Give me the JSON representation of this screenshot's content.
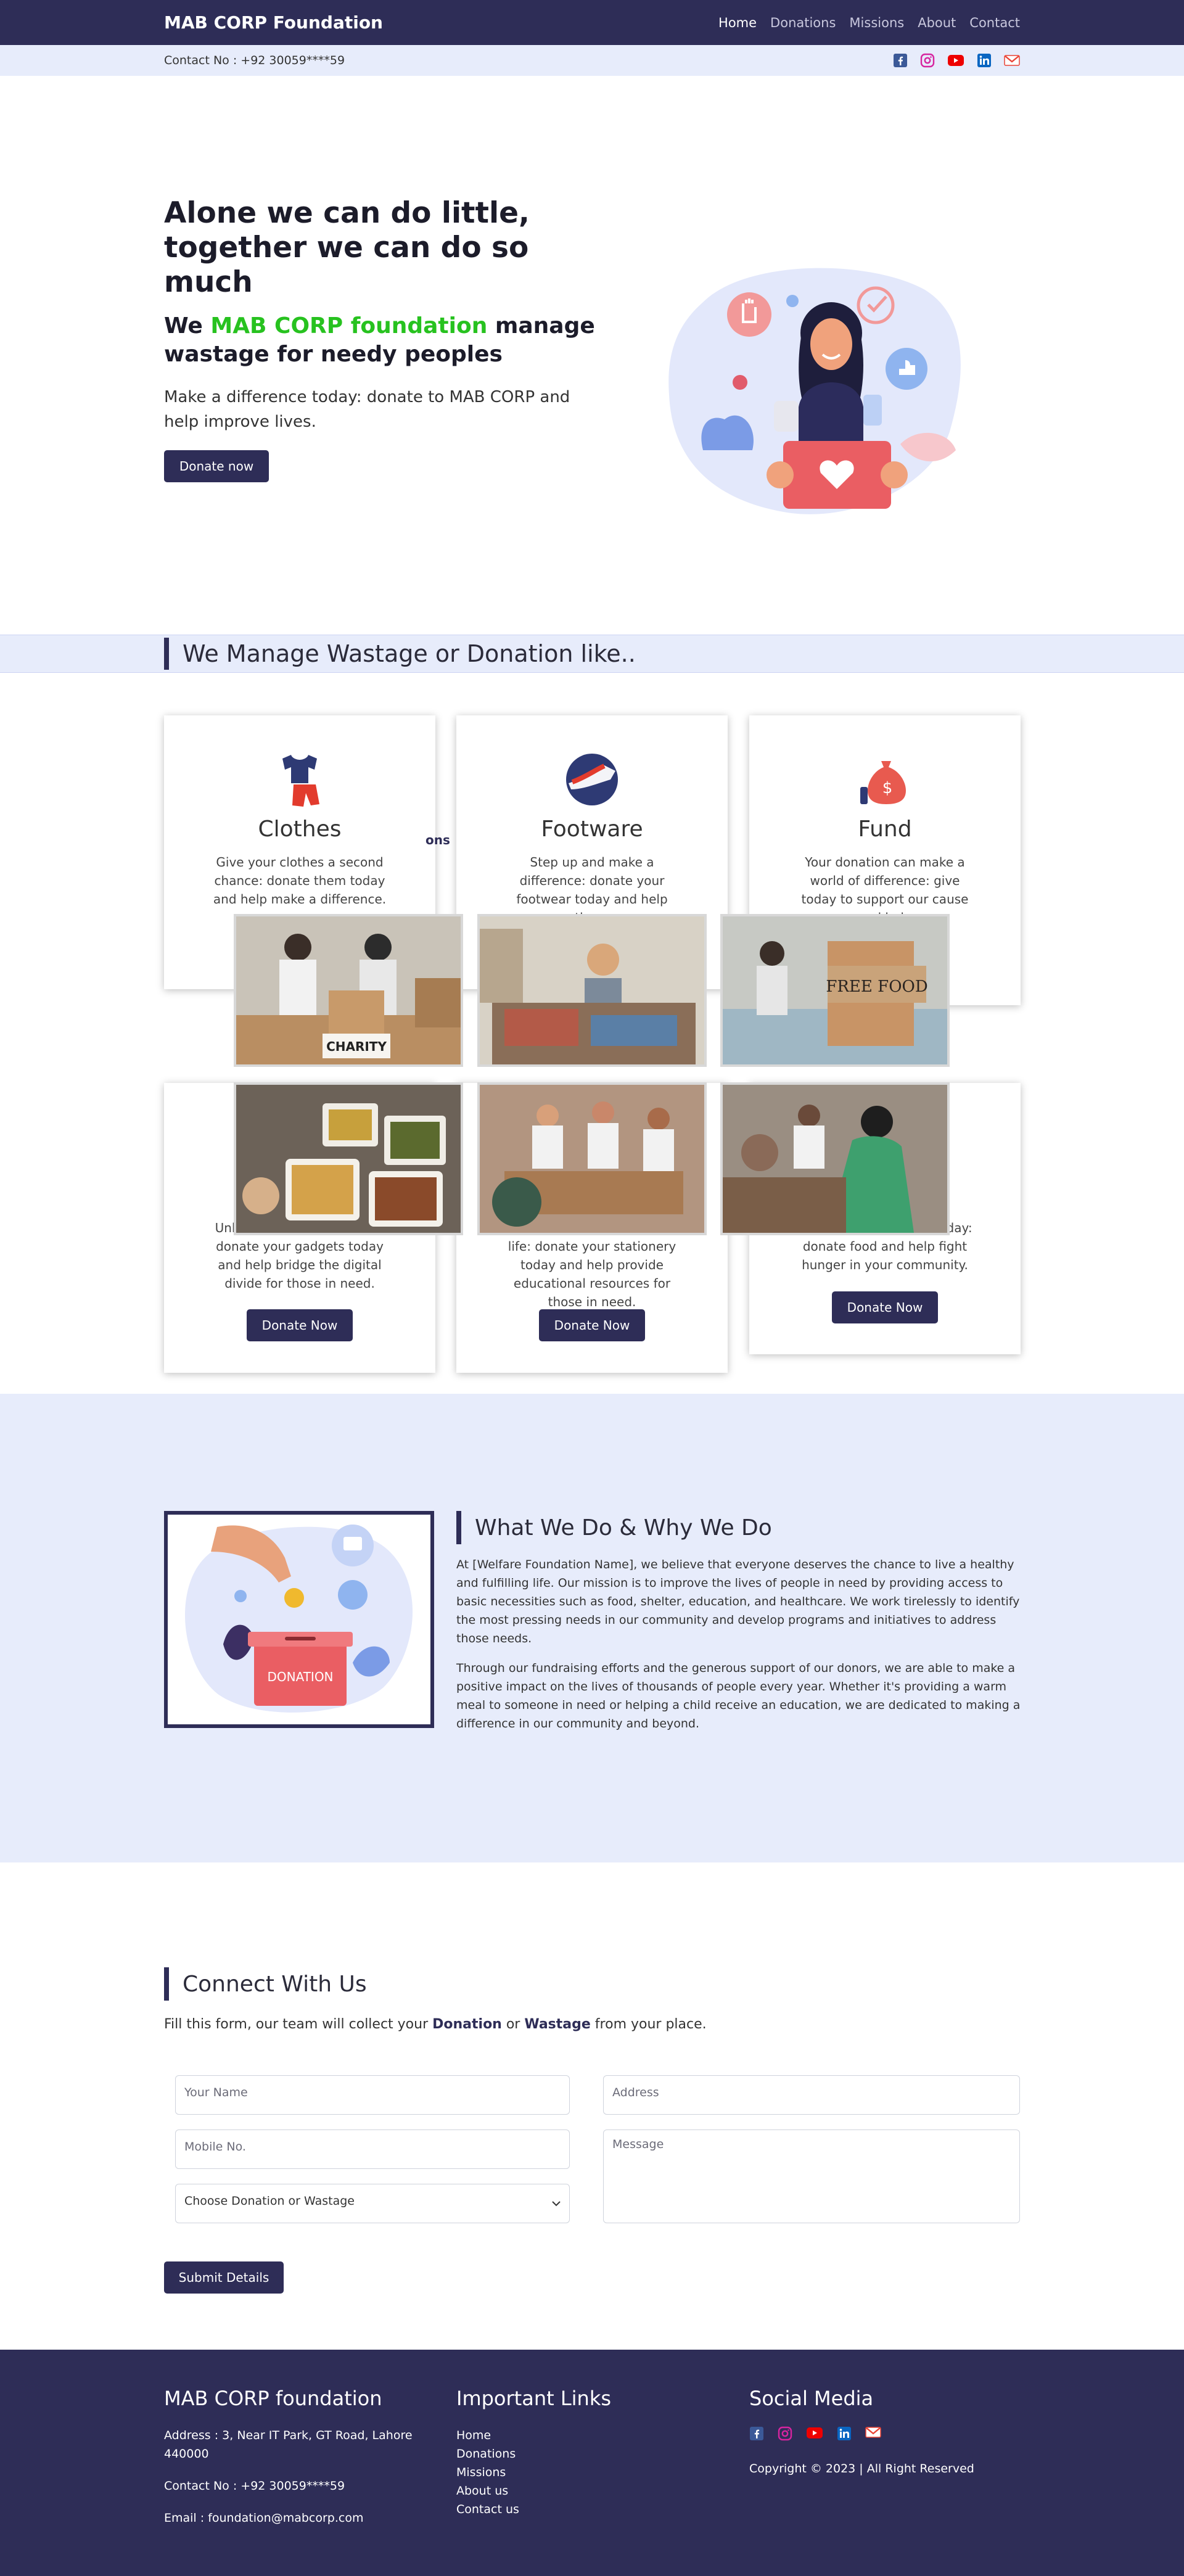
{
  "nav": {
    "brand": "MAB CORP Foundation",
    "links": [
      "Home",
      "Donations",
      "Missions",
      "About",
      "Contact"
    ]
  },
  "contact_bar": {
    "text": "Contact No : +92 30059****59",
    "social_icons": [
      "facebook-icon",
      "instagram-icon",
      "youtube-icon",
      "linkedin-icon",
      "gmail-icon"
    ]
  },
  "hero": {
    "title_line1": "Alone we can do little,",
    "title_line2": "together we can do so much",
    "sub_before": "We ",
    "sub_highlight": "MAB CORP foundation",
    "sub_after": " manage wastage for needy peoples",
    "description": "Make a difference today: donate to MAB CORP and help improve lives.",
    "button": "Donate now"
  },
  "manage": {
    "title": "We Manage Wastage or Donation like..",
    "cards": [
      {
        "title": "Clothes",
        "desc": "Give your clothes a second chance: donate them today and help make a difference."
      },
      {
        "title": "Footware",
        "desc": "Step up and make a difference: donate your footwear today and help those"
      },
      {
        "title": "Fund",
        "desc": "Your donation can make a world of difference: give today to support our cause and help"
      },
      {
        "desc": "Unlock the power of giving: donate your gadgets today and help bridge the digital divide for those in need.",
        "button": "Donate Now"
      },
      {
        "desc": "Make a mark in someone's life: donate your stationery today and help provide educational resources for those in need.",
        "button": "Donate Now"
      },
      {
        "desc": "Feed a hungry mouth today: donate food and help fight hunger in your community.",
        "button": "Donate Now"
      }
    ],
    "overlap_fragment": "ons"
  },
  "whatwedo": {
    "title": "What We Do & Why We Do",
    "para1": "At [Welfare Foundation Name], we believe that everyone deserves the chance to live a healthy and fulfilling life. Our mission is to improve the lives of people in need by providing access to basic necessities such as food, shelter, education, and healthcare. We work tirelessly to identify the most pressing needs in our community and develop programs and initiatives to address those needs.",
    "para2": "Through our fundraising efforts and the generous support of our donors, we are able to make a positive impact on the lives of thousands of people every year. Whether it's providing a warm meal to someone in need or helping a child receive an education, we are dedicated to making a difference in our community and beyond.",
    "image_label": "DONATION"
  },
  "connect": {
    "title": "Connect With Us",
    "desc_before": "Fill this form, our team will collect your ",
    "desc_b1": "Donation",
    "desc_mid": " or ",
    "desc_b2": "Wastage",
    "desc_after": " from your place.",
    "name_placeholder": "Your Name",
    "mobile_placeholder": "Mobile No.",
    "select_value": "Choose Donation or Wastage",
    "address_placeholder": "Address",
    "message_placeholder": "Message",
    "submit": "Submit Details"
  },
  "footer": {
    "col1_title": "MAB CORP foundation",
    "address": "Address : 3, Near IT Park, GT Road, Lahore 440000",
    "contact": "Contact No : +92 30059****59",
    "email": "Email : foundation@mabcorp.com",
    "col2_title": "Important Links",
    "links": [
      "Home",
      "Donations",
      "Missions",
      "About us",
      "Contact us"
    ],
    "col3_title": "Social Media",
    "copyright": "Copyright © 2023 | All Right Reserved"
  },
  "colors": {
    "primary": "#2e2d57",
    "light_bg": "#e7ecfb",
    "highlight_green": "#27c21f"
  }
}
